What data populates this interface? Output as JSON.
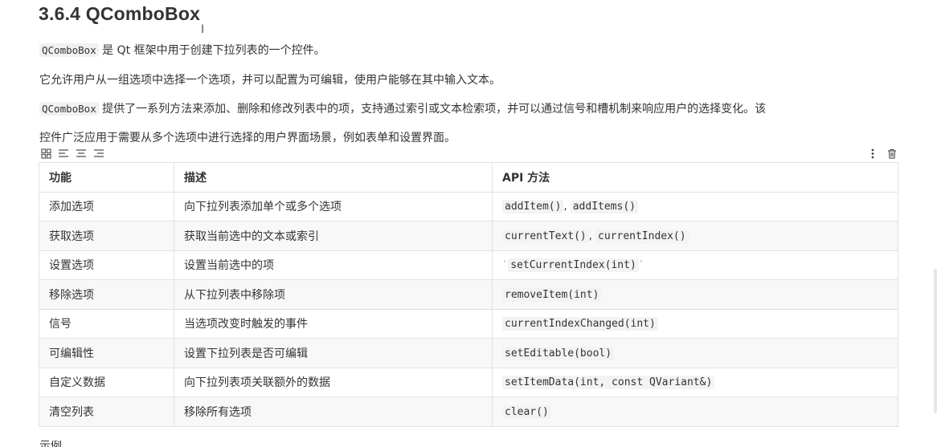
{
  "heading": "3.6.4 QComboBox",
  "cursor_glyph": "I",
  "para1": {
    "code": "QComboBox",
    "text": " 是 Qt 框架中用于创建下拉列表的一个控件。"
  },
  "para2": "它允许用户从一组选项中选择一个选项，并可以配置为可编辑，使用户能够在其中输入文本。",
  "para3": {
    "code": "QComboBox",
    "text": " 提供了一系列方法来添加、删除和修改列表中的项，支持通过索引或文本检索项，并可以通过信号和槽机制来响应用户的选择变化。该"
  },
  "para4": "控件广泛应用于需要从多个选项中进行选择的用户界面场景，例如表单和设置界面。",
  "table": {
    "headers": [
      "功能",
      "描述",
      "API 方法"
    ],
    "rows": [
      {
        "feature": "添加选项",
        "desc": "向下拉列表添加单个或多个选项",
        "api": [
          "addItem()",
          "addItems()"
        ]
      },
      {
        "feature": "获取选项",
        "desc": "获取当前选中的文本或索引",
        "api": [
          "currentText()",
          "currentIndex()"
        ]
      },
      {
        "feature": "设置选项",
        "desc": "设置当前选中的项",
        "api": [
          "setCurrentIndex(int)"
        ]
      },
      {
        "feature": "移除选项",
        "desc": "从下拉列表中移除项",
        "api": [
          "removeItem(int)"
        ]
      },
      {
        "feature": "信号",
        "desc": "当选项改变时触发的事件",
        "api": [
          "currentIndexChanged(int)"
        ]
      },
      {
        "feature": "可编辑性",
        "desc": "设置下拉列表是否可编辑",
        "api": [
          "setEditable(bool)"
        ]
      },
      {
        "feature": "自定义数据",
        "desc": "向下拉列表项关联额外的数据",
        "api": [
          "setItemData(int, const QVariant&)"
        ]
      },
      {
        "feature": "清空列表",
        "desc": "移除所有选项",
        "api": [
          "clear()"
        ]
      }
    ],
    "api_separator": ", ",
    "backtick": "`"
  },
  "cutoff_text": "示例代码",
  "icons": {
    "toolbar_left": [
      "table-grid-icon",
      "align-left-icon",
      "align-center-icon",
      "align-right-icon"
    ],
    "toolbar_right": [
      "more-vertical-icon",
      "trash-icon"
    ]
  }
}
